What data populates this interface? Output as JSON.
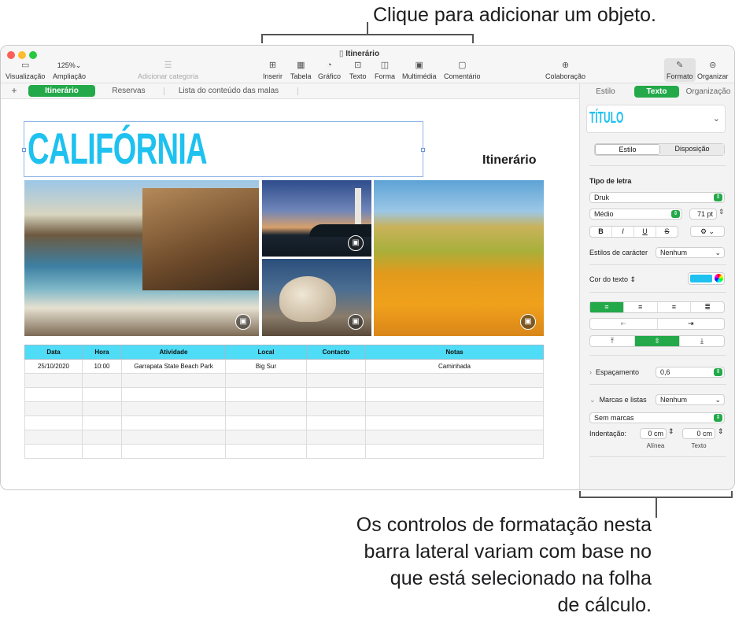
{
  "callouts": {
    "top": "Clique para adicionar um objeto.",
    "bottom_lines": [
      "Os controlos de formatação nesta",
      "barra lateral variam com base no",
      "que está selecionado na folha",
      "de cálculo."
    ]
  },
  "window": {
    "title": "Itinerário"
  },
  "toolbar": {
    "view": "Visualização",
    "zoom_value": "125%",
    "zoom": "Ampliação",
    "add_category": "Adicionar categoria",
    "insert": "Inserir",
    "table": "Tabela",
    "chart": "Gráfico",
    "text": "Texto",
    "shape": "Forma",
    "media": "Multimédia",
    "comment": "Comentário",
    "collaborate": "Colaboração",
    "format": "Formato",
    "organize": "Organizar"
  },
  "sheet_tabs": {
    "add": "+",
    "tabs": [
      "Itinerário",
      "Reservas",
      "Lista do conteúdo das malas"
    ]
  },
  "document": {
    "title": "CALIFÓRNIA",
    "subtitle": "Itinerário",
    "table": {
      "headers": [
        "Data",
        "Hora",
        "Atividade",
        "Local",
        "Contacto",
        "Notas"
      ],
      "rows": [
        [
          "25/10/2020",
          "10:00",
          "Garrapata State Beach Park",
          "Big Sur",
          "",
          "Caminhada"
        ],
        [
          "",
          "",
          "",
          "",
          "",
          ""
        ],
        [
          "",
          "",
          "",
          "",
          "",
          ""
        ],
        [
          "",
          "",
          "",
          "",
          "",
          ""
        ],
        [
          "",
          "",
          "",
          "",
          "",
          ""
        ],
        [
          "",
          "",
          "",
          "",
          "",
          ""
        ],
        [
          "",
          "",
          "",
          "",
          "",
          ""
        ]
      ]
    }
  },
  "sidebar": {
    "tabs": [
      "Estilo",
      "Texto",
      "Organização"
    ],
    "style_name": "TÍTULO",
    "subtabs": [
      "Estilo",
      "Disposição"
    ],
    "font_label": "Tipo de letra",
    "font_name": "Druk",
    "font_weight": "Médio",
    "font_size": "71 pt",
    "bold": "B",
    "italic": "I",
    "underline": "U",
    "strike": "S",
    "char_styles_label": "Estilos de carácter",
    "char_styles_value": "Nenhum",
    "text_color_label": "Cor do texto",
    "text_color": "#1ec1ef",
    "accent": "#23a94a",
    "spacing_label": "Espaçamento",
    "spacing_value": "0,6",
    "bullets_label": "Marcas e listas",
    "bullets_value": "Nenhum",
    "bullet_type": "Sem marcas",
    "indent_label": "Indentação:",
    "indent_first": "0 cm",
    "indent_text": "0 cm",
    "indent_first_label": "Alínea",
    "indent_text_label": "Texto"
  }
}
